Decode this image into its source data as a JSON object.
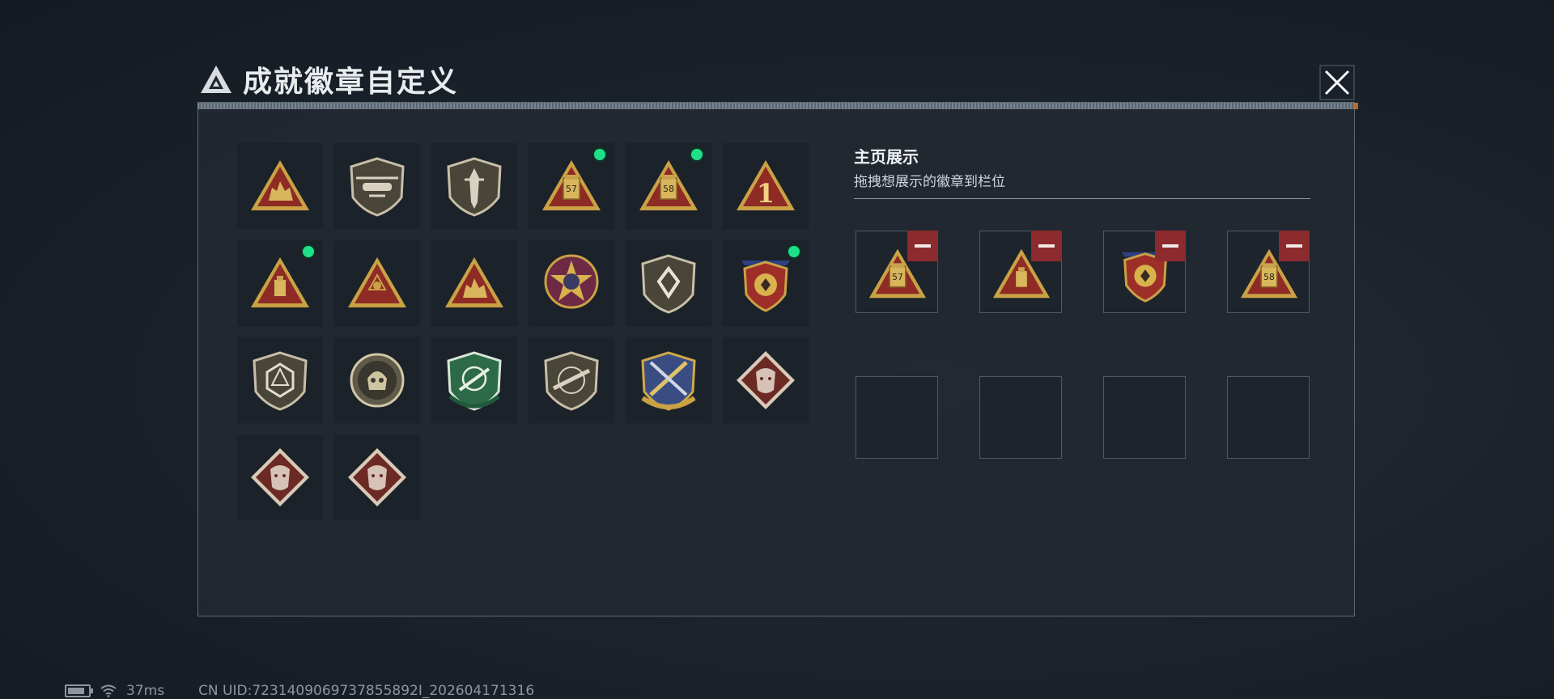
{
  "dialog": {
    "title": "成就徽章自定义",
    "close_icon": "close-icon",
    "accent_color": "#1ee08a",
    "remove_color": "#8c2a2d"
  },
  "badges": [
    {
      "icon": "triangle-emblem-shield-badge",
      "new": false
    },
    {
      "icon": "helicopter-shield-badge",
      "new": false
    },
    {
      "icon": "dagger-shield-badge",
      "new": false
    },
    {
      "icon": "triangle-57-badge",
      "label": "57",
      "new": true
    },
    {
      "icon": "triangle-58-badge",
      "label": "58",
      "new": true
    },
    {
      "icon": "triangle-1-badge",
      "label": "1",
      "new": false
    },
    {
      "icon": "triangle-block-badge",
      "new": true
    },
    {
      "icon": "triangle-hands-badge",
      "new": false
    },
    {
      "icon": "triangle-soldiers-badge",
      "new": false
    },
    {
      "icon": "star-circle-badge",
      "new": false
    },
    {
      "icon": "shield-wing-badge",
      "new": false
    },
    {
      "icon": "laurel-shield-badge",
      "new": true
    },
    {
      "icon": "d20-shield-badge",
      "new": false
    },
    {
      "icon": "skull-circle-badge",
      "new": false
    },
    {
      "icon": "green-crosshair-badge",
      "new": false
    },
    {
      "icon": "rifle-shield-badge",
      "new": false
    },
    {
      "icon": "blue-crossed-rifles-badge",
      "new": false
    },
    {
      "icon": "wolf-diamond-badge",
      "new": false
    },
    {
      "icon": "dragon-diamond-badge",
      "new": false
    },
    {
      "icon": "runner-diamond-badge",
      "new": false
    }
  ],
  "homepage": {
    "title": "主页展示",
    "subtitle": "拖拽想展示的徽章到栏位",
    "slots": [
      {
        "icon": "triangle-57-badge",
        "label": "57",
        "filled": true
      },
      {
        "icon": "triangle-block-badge",
        "filled": true
      },
      {
        "icon": "laurel-shield-badge",
        "filled": true
      },
      {
        "icon": "triangle-58-badge",
        "label": "58",
        "filled": true
      },
      {
        "filled": false
      },
      {
        "filled": false
      },
      {
        "filled": false
      },
      {
        "filled": false
      }
    ]
  },
  "status": {
    "ping": "37ms",
    "uid": "CN UID:7231409069737855892I_202604171316"
  }
}
